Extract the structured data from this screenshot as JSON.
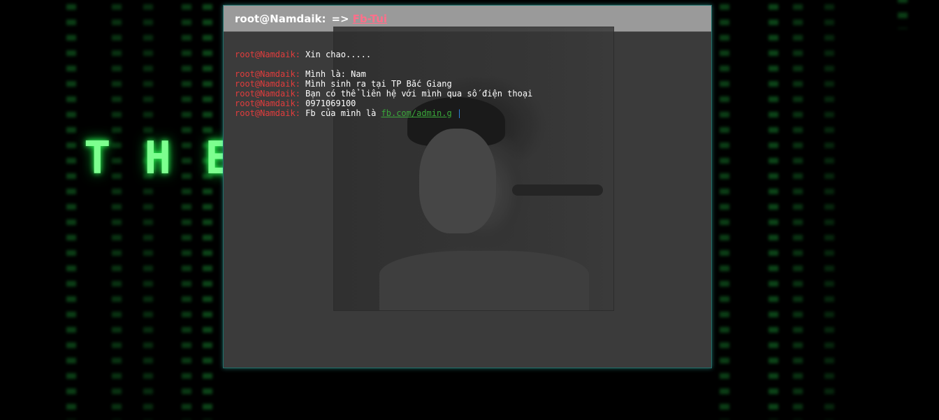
{
  "window": {
    "title": "root@Namdaik:",
    "arrow": "=>",
    "link_label": "Fb-Tui"
  },
  "background_text": "THE MATRIX",
  "terminal": {
    "prompt": "root@Namdaik:",
    "lines": [
      "Xin chao.....",
      "Mình là: Nam",
      "Mình sinh ra tại TP Bắc Giang",
      "Bạn có thể liên hệ với mình qua số điện thoại",
      "0971069100",
      "Fb của mình là "
    ],
    "link_text": "fb.com/admin.g",
    "cursor": "|"
  },
  "colors": {
    "prompt": "#e23c3c",
    "link": "#3aa83a",
    "title_link": "#ff6f8a",
    "matrix_green": "#2dff55"
  }
}
